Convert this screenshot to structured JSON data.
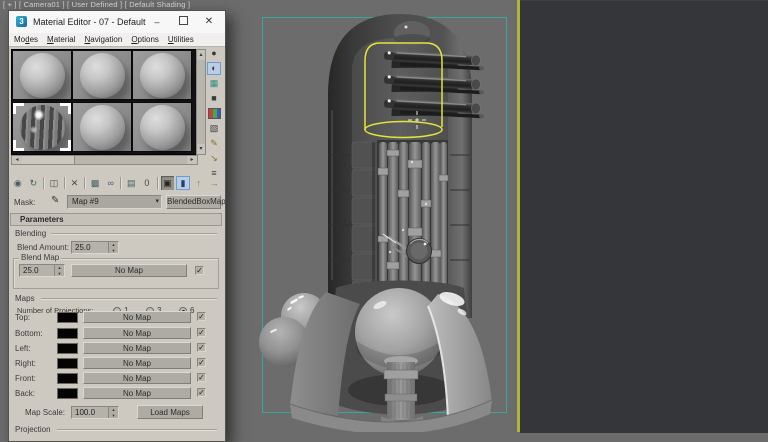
{
  "viewport": {
    "label": "[ + ] [ Camera01 ] [ User Defined ] [ Default Shading ]",
    "background": "#6c6c6c",
    "side_panel_background": "#343639",
    "safe_frame_color": "#3aa6a0",
    "active_viewport_border_color": "#b2b236",
    "selection_gizmo_color": "#e4e43a"
  },
  "editor": {
    "title": "Material Editor - 07 - Default",
    "window_controls": {
      "minimize": "–",
      "close": "✕"
    },
    "menus": [
      {
        "label_pre": "Mo",
        "label_u": "d",
        "label_post": "es"
      },
      {
        "label_pre": "",
        "label_u": "M",
        "label_post": "aterial"
      },
      {
        "label_pre": "",
        "label_u": "N",
        "label_post": "avigation"
      },
      {
        "label_pre": "",
        "label_u": "O",
        "label_post": "ptions"
      },
      {
        "label_pre": "",
        "label_u": "U",
        "label_post": "tilities"
      }
    ],
    "sample_toolbar_vertical": [
      {
        "name": "sample-type-sphere",
        "glyph": "●"
      },
      {
        "name": "backlight",
        "glyph": "◐"
      },
      {
        "name": "background",
        "glyph": "▦"
      },
      {
        "name": "sample-uv-tiling",
        "glyph": "■"
      },
      {
        "name": "video-color-check",
        "glyph": ""
      },
      {
        "name": "make-preview",
        "glyph": "▧"
      },
      {
        "name": "options",
        "glyph": "✎"
      },
      {
        "name": "select-by-material",
        "glyph": "↘"
      },
      {
        "name": "material-map-navigator",
        "glyph": "≡"
      }
    ],
    "main_toolbar": [
      {
        "name": "get-material",
        "glyph": "◉"
      },
      {
        "name": "put-material-to-scene",
        "glyph": "↻"
      },
      {
        "name": "assign-material-to-selection",
        "glyph": "◫"
      },
      {
        "name": "reset-map-mtl",
        "glyph": "✕"
      },
      {
        "name": "make-material-copy",
        "glyph": "▩"
      },
      {
        "name": "make-unique",
        "glyph": "∞"
      },
      {
        "name": "put-to-library",
        "glyph": "▤"
      },
      {
        "name": "material-id-channel",
        "glyph": "0"
      },
      {
        "name": "show-shaded-material-in-viewport",
        "glyph": "▣"
      },
      {
        "name": "show-end-result",
        "glyph": "▮"
      },
      {
        "name": "go-to-parent",
        "glyph": "↑"
      },
      {
        "name": "go-forward-to-sibling",
        "glyph": "→"
      }
    ],
    "scroll": {
      "up": "▴",
      "down": "▾",
      "left": "◂",
      "right": "▸"
    },
    "spinner": {
      "up": "▴",
      "down": "▾"
    },
    "mask_row": {
      "label": "Mask:",
      "picker_glyph": "✎",
      "map_name": "Map #9",
      "dropdown_glyph": "▾",
      "type_button": "BlendedBoxMap"
    },
    "rollout_header": "Parameters",
    "blending": {
      "group_label": "Blending",
      "blend_amount_label": "Blend Amount:",
      "blend_amount_value": "25.0",
      "blend_map_group_label": "Blend Map",
      "blend_map_amount": "25.0",
      "blend_map_button": "No Map",
      "blend_map_check": "✓"
    },
    "maps": {
      "group_label": "Maps",
      "projections_label": "Number of Projections:",
      "projection_options": [
        {
          "label": "1",
          "selected": false
        },
        {
          "label": "3",
          "selected": false
        },
        {
          "label": "6",
          "selected": true
        }
      ],
      "rows": [
        {
          "label": "Top:",
          "button": "No Map",
          "check": "✓"
        },
        {
          "label": "Bottom:",
          "button": "No Map",
          "check": "✓"
        },
        {
          "label": "Left:",
          "button": "No Map",
          "check": "✓"
        },
        {
          "label": "Right:",
          "button": "No Map",
          "check": "✓"
        },
        {
          "label": "Front:",
          "button": "No Map",
          "check": "✓"
        },
        {
          "label": "Back:",
          "button": "No Map",
          "check": "✓"
        }
      ],
      "map_scale_label": "Map Scale:",
      "map_scale_value": "100.0",
      "load_maps_button": "Load Maps"
    },
    "projection_group_label": "Projection"
  }
}
